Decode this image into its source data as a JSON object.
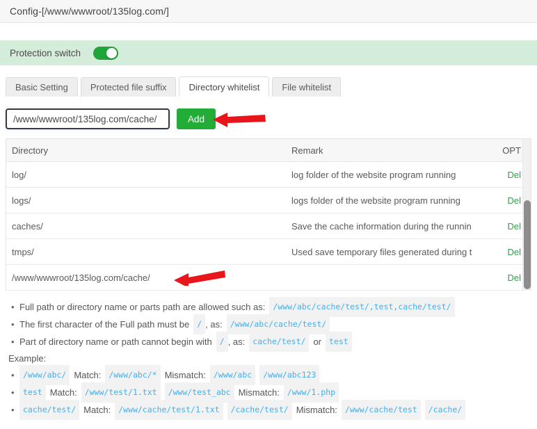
{
  "titlebar": {
    "title": "Config-[/www/wwwroot/135log.com/]"
  },
  "protection": {
    "label": "Protection switch",
    "enabled": true,
    "band_color": "#d4edda",
    "toggle_color": "#20a53a"
  },
  "tabs": [
    {
      "label": "Basic Setting",
      "active": false
    },
    {
      "label": "Protected file suffix",
      "active": false
    },
    {
      "label": "Directory whitelist",
      "active": true
    },
    {
      "label": "File whitelist",
      "active": false
    }
  ],
  "add_row": {
    "input_value": "/www/wwwroot/135log.com/cache/",
    "input_placeholder": "",
    "button_label": "Add",
    "button_color": "#22ac38",
    "annotation_arrow_color": "#e8151a"
  },
  "table": {
    "columns": [
      "Directory",
      "Remark",
      "OPT"
    ],
    "rows": [
      {
        "directory": "log/",
        "remark": "log folder of the website program running",
        "opt": "Del"
      },
      {
        "directory": "logs/",
        "remark": "logs folder of the website program running",
        "opt": "Del"
      },
      {
        "directory": "caches/",
        "remark": "Save the cache information during the runnin",
        "opt": "Del"
      },
      {
        "directory": "tmps/",
        "remark": "Used save temporary files generated during t",
        "opt": "Del"
      },
      {
        "directory": "/www/wwwroot/135log.com/cache/",
        "remark": "",
        "opt": "Del"
      }
    ],
    "opt_link_color": "#2ba245",
    "annotated_row_index": 4
  },
  "help": {
    "rules": [
      {
        "pre": "Full path or directory name or parts path are allowed such as:",
        "codes": [
          "/www/abc/cache/test/,test,cache/test/"
        ]
      },
      {
        "pre": "The first character of the Full path must be",
        "inline_code": "/",
        "mid": ", as:",
        "codes": [
          "/www/abc/cache/test/"
        ]
      },
      {
        "pre": "Part of directory name or path cannot begin with",
        "inline_code": "/",
        "mid": ", as:",
        "codes": [
          "cache/test/"
        ],
        "or_label": "or",
        "codes2": [
          "test"
        ]
      }
    ],
    "example_label": "Example:",
    "examples": [
      {
        "pattern": "/www/abc/",
        "match_label": "Match:",
        "match": [
          "/www/abc/*"
        ],
        "mismatch_label": "Mismatch:",
        "mismatch": [
          "/www/abc",
          "/www/abc123"
        ]
      },
      {
        "pattern": "test",
        "match_label": "Match:",
        "match": [
          "/www/test/1.txt",
          "/www/test_abc"
        ],
        "mismatch_label": "Mismatch:",
        "mismatch": [
          "/www/1.php"
        ]
      },
      {
        "pattern": "cache/test/",
        "match_label": "Match:",
        "match": [
          "/www/cache/test/1.txt",
          "/cache/test/"
        ],
        "mismatch_label": "Mismatch:",
        "mismatch": [
          "/www/cache/test",
          "/cache/"
        ]
      }
    ],
    "bullet_glyph": "•",
    "code_color": "#3fb0f0"
  }
}
